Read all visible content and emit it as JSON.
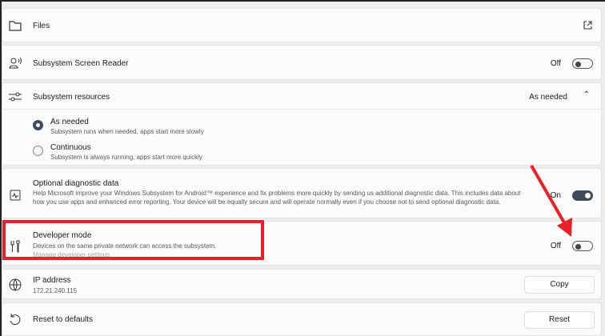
{
  "files": {
    "title": "Files"
  },
  "screen_reader": {
    "title": "Subsystem Screen Reader",
    "state": "Off"
  },
  "resources": {
    "title": "Subsystem resources",
    "value": "As needed",
    "options": [
      {
        "label": "As needed",
        "desc": "Subsystem runs when needed, apps start more slowly",
        "selected": true
      },
      {
        "label": "Continuous",
        "desc": "Subsystem is always running, apps start more quickly",
        "selected": false
      }
    ]
  },
  "diagnostic": {
    "title": "Optional diagnostic data",
    "desc": "Help Microsoft improve your Windows Subsystem for Android™ experience and fix problems more quickly by sending us additional diagnostic data. This includes data about how you use apps and enhanced error reporting. Your device will be equally secure and will operate normally even if you choose not to send optional diagnostic data.",
    "state": "On"
  },
  "developer": {
    "title": "Developer mode",
    "desc": "Devices on the same private network can access the subsystem.",
    "link": "Manage developer settings",
    "state": "Off"
  },
  "ip": {
    "title": "IP address",
    "value": "172.21.240.115",
    "button": "Copy"
  },
  "reset": {
    "title": "Reset to defaults",
    "button": "Reset"
  },
  "annotation_color": "#e8202a"
}
